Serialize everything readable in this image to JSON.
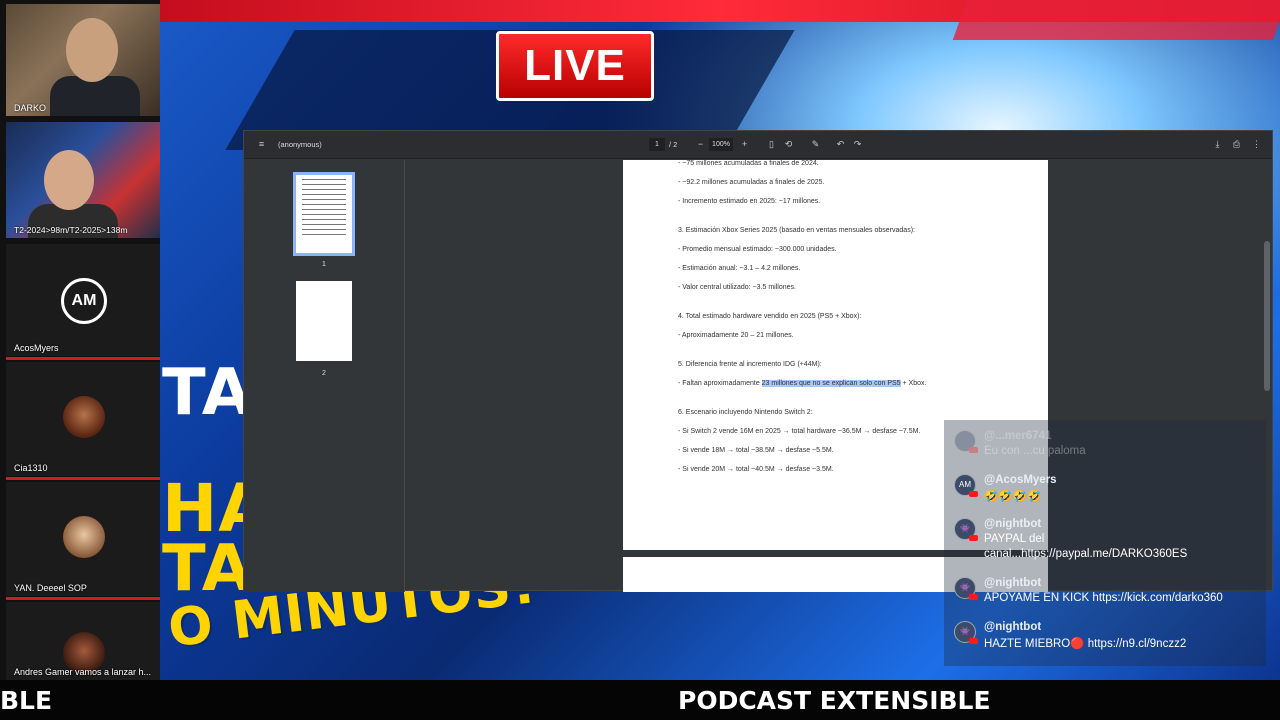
{
  "overlay": {
    "live_label": "LIVE",
    "bg_text_1": "TAT",
    "bg_text_2": "HA",
    "bg_text_3": "TAT",
    "bg_text_4": "O MINUTOS!"
  },
  "cams": [
    {
      "name": "DARKO"
    },
    {
      "name": "T2-2024>98m/T2-2025>138m"
    },
    {
      "name": "AcosMyers",
      "avatar": "AM"
    },
    {
      "name": "Cia1310"
    },
    {
      "name": "YAN. Deeeel SOP"
    },
    {
      "name": "Andres Gamer vamos a lanzar h..."
    }
  ],
  "viewer": {
    "title": "(anonymous)",
    "page_current": "1",
    "page_total": "/ 2",
    "zoom": "100%",
    "thumb1_label": "1",
    "thumb2_label": "2",
    "lines": [
      "- ~75 millones acumuladas a finales de 2024.",
      "- ~92.2 millones acumuladas a finales de 2025.",
      "- Incremento estimado en 2025: ~17 millones.",
      "3. Estimación Xbox Series 2025 (basado en ventas mensuales observadas):",
      "- Promedio mensual estimado: ~300.000 unidades.",
      "- Estimación anual: ~3.1 – 4.2 millones.",
      "- Valor central utilizado: ~3.5 millones.",
      "4. Total estimado hardware vendido en 2025 (PS5 + Xbox):",
      "- Aproximadamente 20 – 21 millones.",
      "5. Diferencia frente al incremento IDG (+44M):",
      "6. Escenario incluyendo Nintendo Switch 2:",
      "- Si Switch 2 vende 16M en 2025 → total hardware ~36.5M → desfase ~7.5M.",
      "- Si vende 18M → total ~38.5M → desfase ~5.5M.",
      "- Si vende 20M → total ~40.5M → desfase ~3.5M."
    ],
    "line_faltan_pre": "- Faltan aproximadamente ",
    "line_faltan_hl": "23 millones que no se explican solo con PS5",
    "line_faltan_post": " + Xbox."
  },
  "chat": [
    {
      "user": "@...mer6741",
      "text": "Eu con ...cu paloma",
      "avatar": ""
    },
    {
      "user": "@AcosMyers",
      "text": "🤣🤣🤣🤣",
      "avatar": "AM"
    },
    {
      "user": "@nightbot",
      "text": "PAYPAL del",
      "text2": "canal...https://paypal.me/DARKO360ES",
      "avatar": "👾"
    },
    {
      "user": "@nightbot",
      "text": "APOYAME EN KICK https://kick.com/darko360",
      "avatar": "👾"
    },
    {
      "user": "@nightbot",
      "text": "HAZTE MIEBRO🔴 https://n9.cl/9nczz2",
      "avatar": "👾"
    }
  ],
  "ticker": {
    "left": "BLE",
    "main": "PODCAST EXTENSIBLE"
  }
}
